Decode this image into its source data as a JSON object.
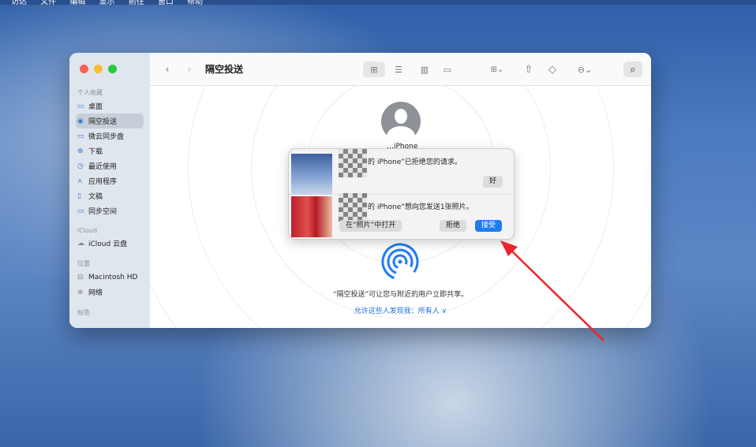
{
  "menubar": {
    "items": [
      "访达",
      "文件",
      "编辑",
      "显示",
      "前往",
      "窗口",
      "帮助"
    ]
  },
  "window": {
    "title": "隔空投送"
  },
  "sidebar": {
    "sections": [
      {
        "label": "个人收藏",
        "items": [
          {
            "label": "桌面",
            "icon": "desktop-icon"
          },
          {
            "label": "隔空投送",
            "icon": "airdrop-icon",
            "active": true
          },
          {
            "label": "微云同步盘",
            "icon": "folder-icon"
          },
          {
            "label": "下载",
            "icon": "download-icon"
          },
          {
            "label": "最近使用",
            "icon": "clock-icon"
          },
          {
            "label": "应用程序",
            "icon": "apps-icon"
          },
          {
            "label": "文稿",
            "icon": "document-icon"
          },
          {
            "label": "同步空间",
            "icon": "folder-icon"
          }
        ]
      },
      {
        "label": "iCloud",
        "items": [
          {
            "label": "iCloud 云盘",
            "icon": "cloud-icon"
          }
        ]
      },
      {
        "label": "位置",
        "items": [
          {
            "label": "Macintosh HD",
            "icon": "disk-icon"
          },
          {
            "label": "网络",
            "icon": "network-icon"
          }
        ]
      },
      {
        "label": "标签",
        "items": []
      }
    ]
  },
  "device": {
    "name": "…iPhone"
  },
  "notifications": [
    {
      "message": "的 iPhone”已拒绝您的请求。",
      "ok": "好"
    },
    {
      "message": "的 iPhone”想向您发送1张照片。",
      "open": "在“照片”中打开",
      "decline": "拒绝",
      "accept": "接受"
    }
  ],
  "main": {
    "caption": "“隔空投送”可让您与附近的用户立即共享。",
    "allow": "允许这些人发现我：所有人 ∨"
  },
  "colors": {
    "accent": "#1f7cf0",
    "arrow": "#e8252a"
  }
}
